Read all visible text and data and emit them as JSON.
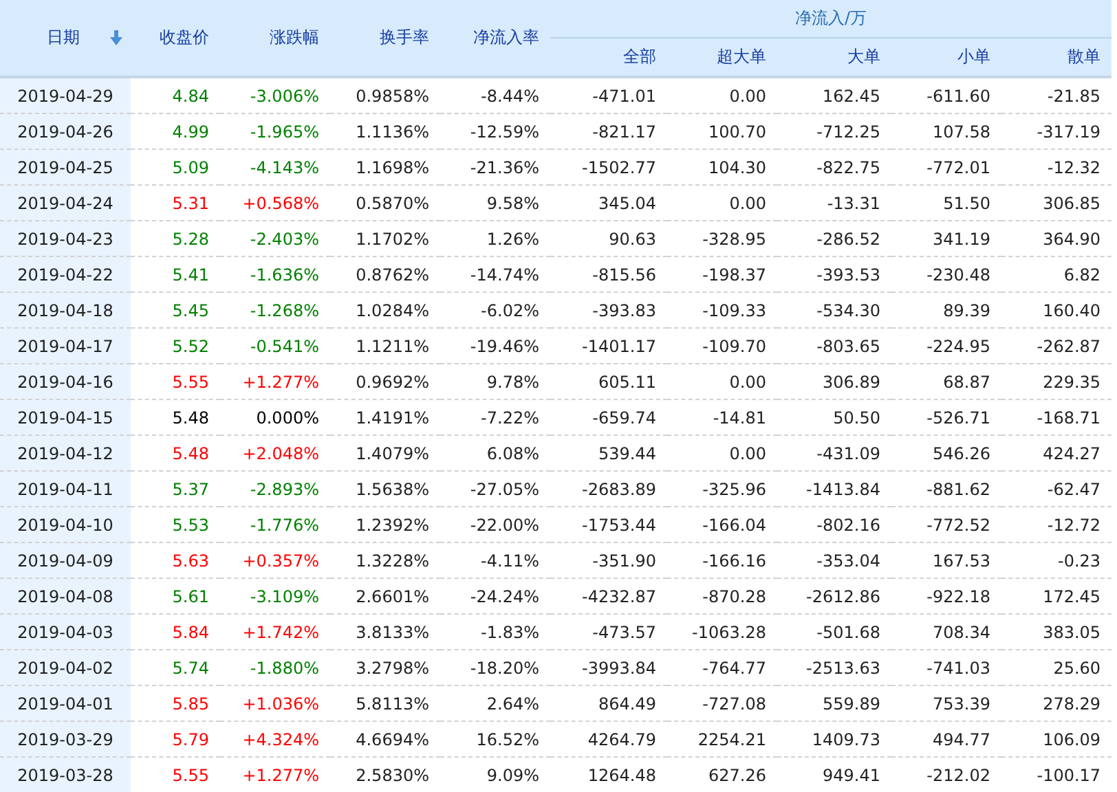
{
  "columns": [
    "日期",
    "收盘价",
    "涨跌幅",
    "换手率",
    "净流入率"
  ],
  "group_header": "净流入/万",
  "sub_columns": [
    "全部",
    "超大单",
    "大单",
    "小单",
    "散单"
  ],
  "rows": [
    {
      "date": "2019-04-29",
      "color": "#008000",
      "close": "4.84",
      "change": "-3.006%",
      "turnover": "0.9858%",
      "rate": "-8.44%",
      "flows": [
        "-471.01",
        "0.00",
        "162.45",
        "-611.60",
        "-21.85"
      ]
    },
    {
      "date": "2019-04-26",
      "color": "#008000",
      "close": "4.99",
      "change": "-1.965%",
      "turnover": "1.1136%",
      "rate": "-12.59%",
      "flows": [
        "-821.17",
        "100.70",
        "-712.25",
        "107.58",
        "-317.19"
      ]
    },
    {
      "date": "2019-04-25",
      "color": "#008000",
      "close": "5.09",
      "change": "-4.143%",
      "turnover": "1.1698%",
      "rate": "-21.36%",
      "flows": [
        "-1502.77",
        "104.30",
        "-822.75",
        "-772.01",
        "-12.32"
      ]
    },
    {
      "date": "2019-04-24",
      "color": "#ff0000",
      "close": "5.31",
      "change": "+0.568%",
      "turnover": "0.5870%",
      "rate": "9.58%",
      "flows": [
        "345.04",
        "0.00",
        "-13.31",
        "51.50",
        "306.85"
      ]
    },
    {
      "date": "2019-04-23",
      "color": "#008000",
      "close": "5.28",
      "change": "-2.403%",
      "turnover": "1.1702%",
      "rate": "1.26%",
      "flows": [
        "90.63",
        "-328.95",
        "-286.52",
        "341.19",
        "364.90"
      ]
    },
    {
      "date": "2019-04-22",
      "color": "#008000",
      "close": "5.41",
      "change": "-1.636%",
      "turnover": "0.8762%",
      "rate": "-14.74%",
      "flows": [
        "-815.56",
        "-198.37",
        "-393.53",
        "-230.48",
        "6.82"
      ]
    },
    {
      "date": "2019-04-18",
      "color": "#008000",
      "close": "5.45",
      "change": "-1.268%",
      "turnover": "1.0284%",
      "rate": "-6.02%",
      "flows": [
        "-393.83",
        "-109.33",
        "-534.30",
        "89.39",
        "160.40"
      ]
    },
    {
      "date": "2019-04-17",
      "color": "#008000",
      "close": "5.52",
      "change": "-0.541%",
      "turnover": "1.1211%",
      "rate": "-19.46%",
      "flows": [
        "-1401.17",
        "-109.70",
        "-803.65",
        "-224.95",
        "-262.87"
      ]
    },
    {
      "date": "2019-04-16",
      "color": "#ff0000",
      "close": "5.55",
      "change": "+1.277%",
      "turnover": "0.9692%",
      "rate": "9.78%",
      "flows": [
        "605.11",
        "0.00",
        "306.89",
        "68.87",
        "229.35"
      ]
    },
    {
      "date": "2019-04-15",
      "color": "#000000",
      "close": "5.48",
      "change": "0.000%",
      "turnover": "1.4191%",
      "rate": "-7.22%",
      "flows": [
        "-659.74",
        "-14.81",
        "50.50",
        "-526.71",
        "-168.71"
      ]
    },
    {
      "date": "2019-04-12",
      "color": "#ff0000",
      "close": "5.48",
      "change": "+2.048%",
      "turnover": "1.4079%",
      "rate": "6.08%",
      "flows": [
        "539.44",
        "0.00",
        "-431.09",
        "546.26",
        "424.27"
      ]
    },
    {
      "date": "2019-04-11",
      "color": "#008000",
      "close": "5.37",
      "change": "-2.893%",
      "turnover": "1.5638%",
      "rate": "-27.05%",
      "flows": [
        "-2683.89",
        "-325.96",
        "-1413.84",
        "-881.62",
        "-62.47"
      ]
    },
    {
      "date": "2019-04-10",
      "color": "#008000",
      "close": "5.53",
      "change": "-1.776%",
      "turnover": "1.2392%",
      "rate": "-22.00%",
      "flows": [
        "-1753.44",
        "-166.04",
        "-802.16",
        "-772.52",
        "-12.72"
      ]
    },
    {
      "date": "2019-04-09",
      "color": "#ff0000",
      "close": "5.63",
      "change": "+0.357%",
      "turnover": "1.3228%",
      "rate": "-4.11%",
      "flows": [
        "-351.90",
        "-166.16",
        "-353.04",
        "167.53",
        "-0.23"
      ]
    },
    {
      "date": "2019-04-08",
      "color": "#008000",
      "close": "5.61",
      "change": "-3.109%",
      "turnover": "2.6601%",
      "rate": "-24.24%",
      "flows": [
        "-4232.87",
        "-870.28",
        "-2612.86",
        "-922.18",
        "172.45"
      ]
    },
    {
      "date": "2019-04-03",
      "color": "#ff0000",
      "close": "5.84",
      "change": "+1.742%",
      "turnover": "3.8133%",
      "rate": "-1.83%",
      "flows": [
        "-473.57",
        "-1063.28",
        "-501.68",
        "708.34",
        "383.05"
      ]
    },
    {
      "date": "2019-04-02",
      "color": "#008000",
      "close": "5.74",
      "change": "-1.880%",
      "turnover": "3.2798%",
      "rate": "-18.20%",
      "flows": [
        "-3993.84",
        "-764.77",
        "-2513.63",
        "-741.03",
        "25.60"
      ]
    },
    {
      "date": "2019-04-01",
      "color": "#ff0000",
      "close": "5.85",
      "change": "+1.036%",
      "turnover": "5.8113%",
      "rate": "2.64%",
      "flows": [
        "864.49",
        "-727.08",
        "559.89",
        "753.39",
        "278.29"
      ]
    },
    {
      "date": "2019-03-29",
      "color": "#ff0000",
      "close": "5.79",
      "change": "+4.324%",
      "turnover": "4.6694%",
      "rate": "16.52%",
      "flows": [
        "4264.79",
        "2254.21",
        "1409.73",
        "494.77",
        "106.09"
      ]
    },
    {
      "date": "2019-03-28",
      "color": "#ff0000",
      "close": "5.55",
      "change": "+1.277%",
      "turnover": "2.5830%",
      "rate": "9.09%",
      "flows": [
        "1264.48",
        "627.26",
        "949.41",
        "-212.02",
        "-100.17"
      ]
    }
  ]
}
